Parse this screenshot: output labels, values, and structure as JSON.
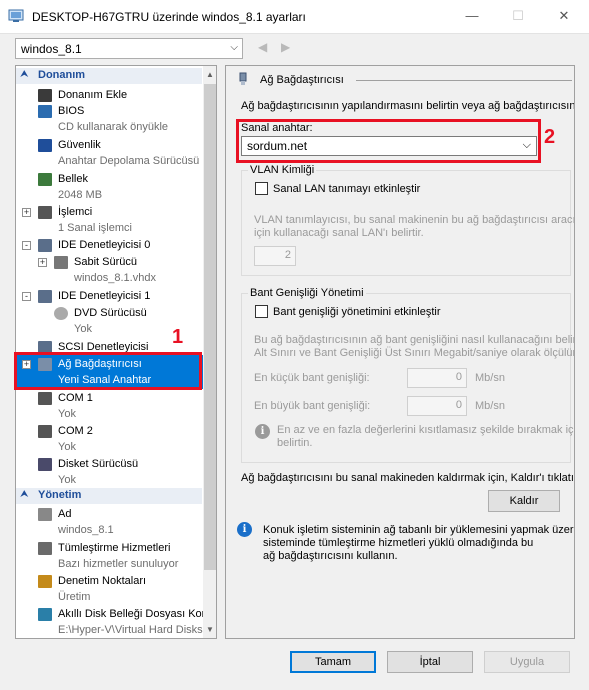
{
  "window": {
    "title": "DESKTOP-H67GTRU üzerinde windos_8.1 ayarları",
    "minimize_glyph": "—",
    "maximize_glyph": "☐",
    "close_glyph": "✕"
  },
  "vm_selector": {
    "value": "windos_8.1",
    "back_glyph": "◀",
    "forward_glyph": "▶",
    "arrow_glyph": "⌵"
  },
  "tree": {
    "hardware_header": "Donanım",
    "management_header": "Yönetim",
    "items": [
      {
        "label": "Donanım Ekle",
        "sub": "",
        "icon": "add-hardware-icon"
      },
      {
        "label": "BIOS",
        "sub": "CD kullanarak önyükle",
        "icon": "bios-icon"
      },
      {
        "label": "Güvenlik",
        "sub": "Anahtar Depolama Sürücüsü",
        "icon": "shield-icon"
      },
      {
        "label": "Bellek",
        "sub": "2048 MB",
        "icon": "memory-icon"
      },
      {
        "label": "İşlemci",
        "sub": "1 Sanal işlemci",
        "icon": "processor-icon"
      },
      {
        "label": "IDE Denetleyicisi 0",
        "sub": "",
        "icon": "ide-controller-icon"
      },
      {
        "label": "Sabit Sürücü",
        "sub": "windos_8.1.vhdx",
        "icon": "hard-drive-icon"
      },
      {
        "label": "IDE Denetleyicisi 1",
        "sub": "",
        "icon": "ide-controller-icon"
      },
      {
        "label": "DVD Sürücüsü",
        "sub": "Yok",
        "icon": "dvd-icon"
      },
      {
        "label": "SCSI Denetleyicisi",
        "sub": "",
        "icon": "scsi-icon"
      },
      {
        "label": "Ağ Bağdaştırıcısı",
        "sub": "Yeni Sanal Anahtar",
        "icon": "network-adapter-icon"
      },
      {
        "label": "COM 1",
        "sub": "Yok",
        "icon": "com-port-icon"
      },
      {
        "label": "COM 2",
        "sub": "Yok",
        "icon": "com-port-icon"
      },
      {
        "label": "Disket Sürücüsü",
        "sub": "Yok",
        "icon": "floppy-icon"
      },
      {
        "label": "Ad",
        "sub": "windos_8.1",
        "icon": "name-icon"
      },
      {
        "label": "Tümleştirme Hizmetleri",
        "sub": "Bazı hizmetler sunuluyor",
        "icon": "integration-services-icon"
      },
      {
        "label": "Denetim Noktaları",
        "sub": "Üretim",
        "icon": "checkpoint-icon"
      },
      {
        "label": "Akıllı Disk Belleği Dosyası Konumu",
        "sub": "E:\\Hyper-V\\Virtual Hard Disks",
        "icon": "smart-paging-icon"
      }
    ],
    "annotation": "1",
    "scroll_up_glyph": "▲",
    "scroll_down_glyph": "▼"
  },
  "panel": {
    "header": "Ağ Bağdaştırıcısı",
    "intro": "Ağ bağdaştırıcısının yapılandırmasını belirtin veya ağ bağdaştırıcısını ka",
    "switch_label": "Sanal anahtar:",
    "switch_value": "sordum.net",
    "dropdown_arrow_glyph": "⌵",
    "annotation": "2",
    "vlan": {
      "group_label": "VLAN Kimliği",
      "checkbox_label": "Sanal LAN tanımayı etkinleştir",
      "desc_line1": "VLAN tanımlayıcısı, bu sanal makinenin bu ağ bağdaştırıcısı aracılı",
      "desc_line2": "için kullanacağı sanal LAN'ı belirtir.",
      "value": "2"
    },
    "bandwidth": {
      "group_label": "Bant Genişliği Yönetimi",
      "checkbox_label": "Bant genişliği yönetimini etkinleştir",
      "desc_line1": "Bu ağ bağdaştırıcısının ağ bant genişliğini nasıl kullanacağını belirt",
      "desc_line2": "Alt Sınırı ve Bant Genişliği Üst Sınırı Megabit/saniye olarak ölçülür",
      "min_label": "En küçük bant genişliği:",
      "min_value": "0",
      "max_label": "En büyük bant genişliği:",
      "max_value": "0",
      "unit": "Mb/sn",
      "note_line1": "En az ve en fazla değerlerini kısıtlamasız şekilde bırakmak içi",
      "note_line2": "belirtin."
    },
    "remove_text": "Ağ bağdaştırıcısını bu sanal makineden kaldırmak için, Kaldır'ı tıklatın",
    "remove_button": "Kaldır",
    "info_line1": "Konuk işletim sisteminin ağ tabanlı bir yüklemesini yapmak üzere",
    "info_line2": "sisteminde tümleştirme hizmetleri yüklü olmadığında bu",
    "info_line3": "ağ bağdaştırıcısını kullanın.",
    "info_glyph": "i"
  },
  "buttons": {
    "ok": "Tamam",
    "cancel": "İptal",
    "apply": "Uygula"
  }
}
